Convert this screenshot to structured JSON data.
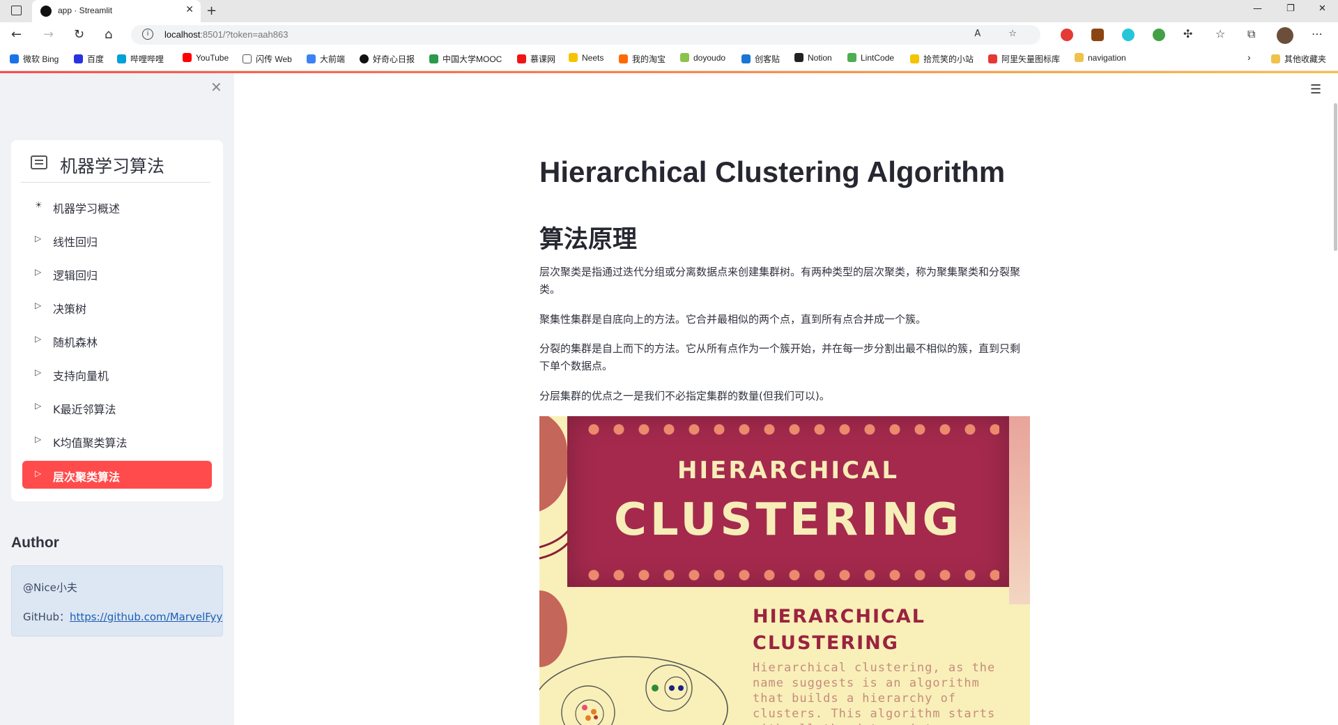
{
  "browser": {
    "tab_title": "app · Streamlit",
    "url_host": "localhost",
    "url_rest": ":8501/?token=aah863",
    "bookmarks": [
      {
        "label": "微软 Bing",
        "color": "#1a73e8"
      },
      {
        "label": "百度",
        "color": "#2932e1"
      },
      {
        "label": "哔哩哔哩",
        "color": "#00a1d6"
      },
      {
        "label": "YouTube",
        "color": "#ff0000"
      },
      {
        "label": "闪传 Web",
        "color": "#555555"
      },
      {
        "label": "大前端",
        "color": "#3b82f6"
      },
      {
        "label": "好奇心日报",
        "color": "#111111"
      },
      {
        "label": "中国大学MOOC",
        "color": "#2b9a4a"
      },
      {
        "label": "慕课网",
        "color": "#f01414"
      },
      {
        "label": "Neets",
        "color": "#f5c400"
      },
      {
        "label": "我的淘宝",
        "color": "#ff6a00"
      },
      {
        "label": "doyoudo",
        "color": "#8bc34a"
      },
      {
        "label": "创客贴",
        "color": "#1976d2"
      },
      {
        "label": "Notion",
        "color": "#222222"
      },
      {
        "label": "LintCode",
        "color": "#4caf50"
      },
      {
        "label": "拾荒笑的小站",
        "color": "#f5c400"
      },
      {
        "label": "阿里矢量图标库",
        "color": "#e53935"
      },
      {
        "label": "navigation",
        "color": "#f0c24d"
      }
    ],
    "other_bookmarks": "其他收藏夹"
  },
  "sidebar": {
    "menu_title": "机器学习算法",
    "items": [
      {
        "label": "机器学习概述",
        "icon": "☀",
        "active": false
      },
      {
        "label": "线性回归",
        "icon": "▷",
        "active": false
      },
      {
        "label": "逻辑回归",
        "icon": "▷",
        "active": false
      },
      {
        "label": "决策树",
        "icon": "▷",
        "active": false
      },
      {
        "label": "随机森林",
        "icon": "▷",
        "active": false
      },
      {
        "label": "支持向量机",
        "icon": "▷",
        "active": false
      },
      {
        "label": "K最近邻算法",
        "icon": "▷",
        "active": false
      },
      {
        "label": "K均值聚类算法",
        "icon": "▷",
        "active": false
      },
      {
        "label": "层次聚类算法",
        "icon": "▷",
        "active": true
      }
    ],
    "author_heading": "Author",
    "author_name": "@Nice小夫",
    "github_label": "GitHub：",
    "github_url": "https://github.com/MarvelFyy"
  },
  "main": {
    "title": "Hierarchical Clustering Algorithm",
    "subtitle": "算法原理",
    "paragraphs": [
      "层次聚类是指通过迭代分组或分离数据点来创建集群树。有两种类型的层次聚类，称为聚集聚类和分裂聚类。",
      "聚集性集群是自底向上的方法。它合并最相似的两个点，直到所有点合并成一个簇。",
      "分裂的集群是自上而下的方法。它从所有点作为一个簇开始，并在每一步分割出最不相似的簇，直到只剩下单个数据点。",
      "分层集群的优点之一是我们不必指定集群的数量(但我们可以)。"
    ],
    "poster": {
      "banner_small": "HIERARCHICAL",
      "banner_big": "CLUSTERING",
      "sub_line1": "HIERARCHICAL",
      "sub_line2": "CLUSTERING",
      "description": "Hierarchical clustering, as the name suggests is an algorithm that builds a hierarchy of clusters. This algorithm starts with all the data points assigned to a cluster of their"
    }
  },
  "colors": {
    "accent": "#ff4b4b",
    "sidebar_bg": "#f0f2f6",
    "poster_maroon": "#a4294d",
    "poster_cream": "#f8f0b8"
  }
}
